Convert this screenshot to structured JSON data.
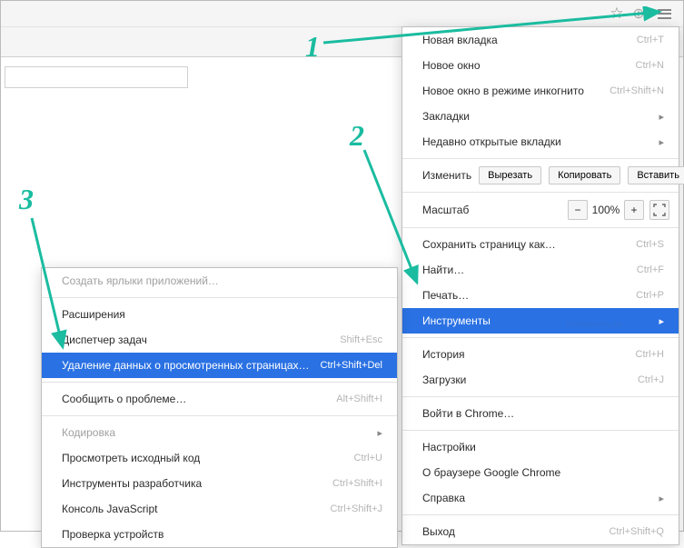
{
  "annotations": {
    "n1": "1",
    "n2": "2",
    "n3": "3"
  },
  "watermark": "inetsovety.ru",
  "mainMenu": {
    "newTab": {
      "label": "Новая вкладка",
      "shortcut": "Ctrl+T"
    },
    "newWindow": {
      "label": "Новое окно",
      "shortcut": "Ctrl+N"
    },
    "incognito": {
      "label": "Новое окно в режиме инкогнито",
      "shortcut": "Ctrl+Shift+N"
    },
    "bookmarks": {
      "label": "Закладки"
    },
    "recentTabs": {
      "label": "Недавно открытые вкладки"
    },
    "editLabel": "Изменить",
    "cut": "Вырезать",
    "copy": "Копировать",
    "paste": "Вставить",
    "zoomLabel": "Масштаб",
    "zoomValue": "100%",
    "saveAs": {
      "label": "Сохранить страницу как…",
      "shortcut": "Ctrl+S"
    },
    "find": {
      "label": "Найти…",
      "shortcut": "Ctrl+F"
    },
    "print": {
      "label": "Печать…",
      "shortcut": "Ctrl+P"
    },
    "tools": {
      "label": "Инструменты"
    },
    "history": {
      "label": "История",
      "shortcut": "Ctrl+H"
    },
    "downloads": {
      "label": "Загрузки",
      "shortcut": "Ctrl+J"
    },
    "signIn": {
      "label": "Войти в Chrome…"
    },
    "settings": {
      "label": "Настройки"
    },
    "about": {
      "label": "О браузере Google Chrome"
    },
    "help": {
      "label": "Справка"
    },
    "exit": {
      "label": "Выход",
      "shortcut": "Ctrl+Shift+Q"
    }
  },
  "subMenu": {
    "createShortcuts": {
      "label": "Создать ярлыки приложений…"
    },
    "extensions": {
      "label": "Расширения"
    },
    "taskManager": {
      "label": "Диспетчер задач",
      "shortcut": "Shift+Esc"
    },
    "clearData": {
      "label": "Удаление данных о просмотренных страницах…",
      "shortcut": "Ctrl+Shift+Del"
    },
    "report": {
      "label": "Сообщить о проблеме…",
      "shortcut": "Alt+Shift+I"
    },
    "encoding": {
      "label": "Кодировка"
    },
    "viewSource": {
      "label": "Просмотреть исходный код",
      "shortcut": "Ctrl+U"
    },
    "devTools": {
      "label": "Инструменты разработчика",
      "shortcut": "Ctrl+Shift+I"
    },
    "jsConsole": {
      "label": "Консоль JavaScript",
      "shortcut": "Ctrl+Shift+J"
    },
    "inspectDevices": {
      "label": "Проверка устройств"
    }
  }
}
